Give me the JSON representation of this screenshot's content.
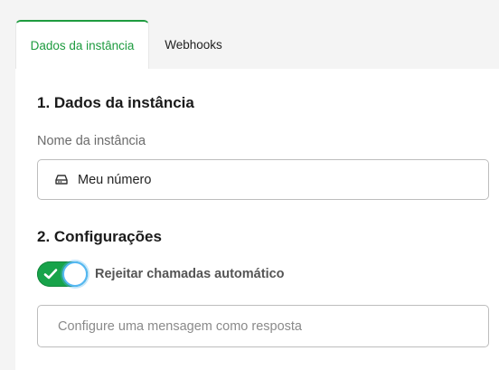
{
  "tabs": [
    {
      "label": "Dados da instância",
      "active": true
    },
    {
      "label": "Webhooks",
      "active": false
    }
  ],
  "section1": {
    "title": "1. Dados da instância",
    "field_label": "Nome da instância",
    "field_value": "Meu número",
    "field_icon": "hard-drive-icon"
  },
  "section2": {
    "title": "2. Configurações",
    "toggle_label": "Rejeitar chamadas automático",
    "toggle_on": true,
    "message_placeholder": "Configure uma mensagem como resposta"
  },
  "colors": {
    "accent": "#1e9b3f",
    "toggle": "#17a34a",
    "focus_ring": "#55b8f4"
  }
}
